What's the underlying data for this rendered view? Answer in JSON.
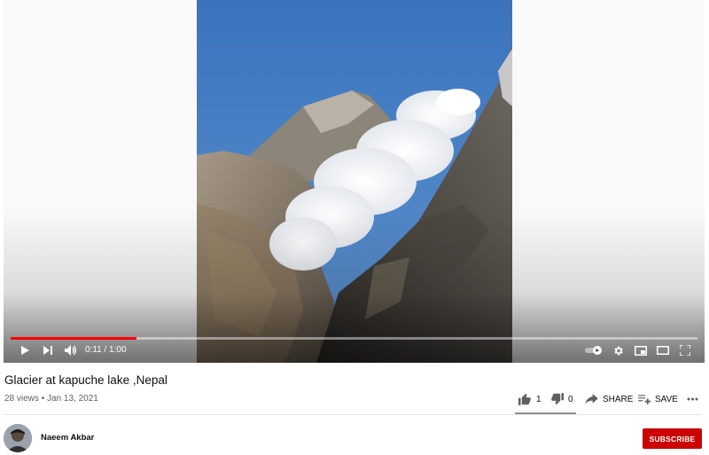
{
  "video": {
    "title": "Glacier at kapuche lake ,Nepal",
    "time_display": "0:11 / 1:00",
    "progress": 0.183,
    "views": "28 views",
    "separator": "•",
    "date": "Jan 13, 2021"
  },
  "actions": {
    "like_count": "1",
    "dislike_count": "0",
    "share_label": "SHARE",
    "save_label": "SAVE"
  },
  "channel": {
    "name": "Naeem Akbar",
    "subscribe_label": "SUBSCRIBE"
  },
  "colors": {
    "progress": "#ff0000",
    "subscribe": "#cc0000",
    "sky": "#3f78bd"
  },
  "icons": {
    "play": "play-icon",
    "next": "skip-next-icon",
    "volume": "volume-icon",
    "autoplay": "autoplay-toggle-icon",
    "settings": "gear-icon",
    "miniplayer": "miniplayer-icon",
    "theater": "theater-mode-icon",
    "fullscreen": "fullscreen-icon",
    "like": "thumbs-up-icon",
    "dislike": "thumbs-down-icon",
    "share": "share-arrow-icon",
    "save": "playlist-add-icon",
    "more": "more-horizontal-icon"
  }
}
